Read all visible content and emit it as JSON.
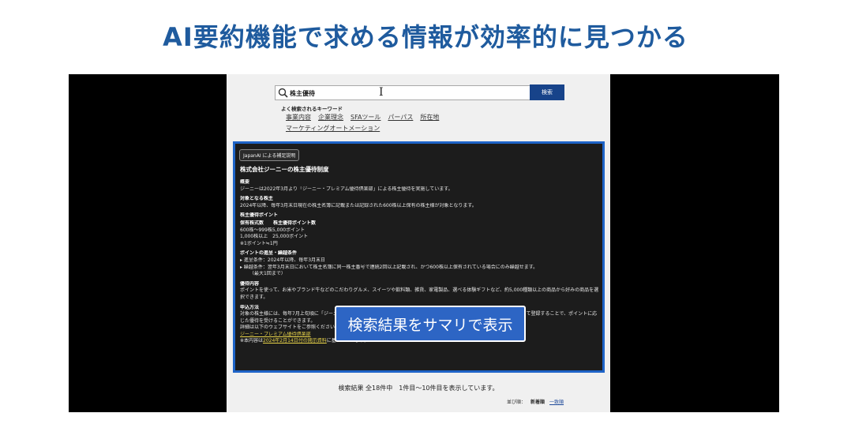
{
  "headline": "AI要約機能で求める情報が効率的に見つかる",
  "search": {
    "value": "株主優待",
    "button_label": "検索"
  },
  "keywords": {
    "title": "よく検索されるキーワード",
    "items": [
      "事業内容",
      "企業理念",
      "SFAツール",
      "パーパス",
      "所在地",
      "マーケティングオートメーション"
    ]
  },
  "ai_summary": {
    "badge": "JapanAI による補足説明",
    "title": "株式会社ジーニーの株主優待制度",
    "overview_head": "概要",
    "overview_text": "ジーニーは2022年3月より「ジーニー・プレミアム優待倶楽部」による株主優待を実施しています。",
    "target_head": "対象となる株主",
    "target_text": "2024年以降、毎年3月末日現在の株主名簿に記載または記録された600株以上保有の株主様が対象となります。",
    "points_head": "株主優待ポイント",
    "points_table_header": "保有株式数　　株主優待ポイント数",
    "points_row1": "600株〜999株5,000ポイント",
    "points_row2": "1,000株以上　25,000ポイント",
    "points_note": "※1ポイント≒1円",
    "carry_head": "ポイントの進呈・繰越条件",
    "carry_item1": "進呈条件：2024年以降、毎年3月末日",
    "carry_item2": "繰越条件：翌年3月末日において株主名簿に同一株主番号で連続2回以上記載され、かつ600株以上保有されている場合にのみ繰越せます。",
    "carry_item2_note": "（最大1回まで）",
    "content_head": "優待内容",
    "content_text": "ポイントを使って、お米やブランド牛などのこだわりグルメ、スイーツや飲料類、雑貨、家電製品、選べる体験ギフトなど、約5,000種類以上の商品から好みの商品を選択できます。",
    "apply_head": "申込方法",
    "apply_text": "対象の株主様には、毎年7月上旬頃に「ジーニー・プレミアム優待倶楽部のご案内」が送付されます。案内に従って特設ウェブサイトにて登録することで、ポイントに応じた優待を受けることができます。",
    "details_text": "詳細は以下のウェブサイトをご参照ください：",
    "link_text": "ジーニー・プレミアム優待倶楽部",
    "source_prefix": "※本内容は",
    "source_link": "2024年2月14日付の開示資料",
    "source_suffix": "に基づいています。"
  },
  "overlay_label": "検索結果をサマリで表示",
  "results": {
    "count_text": "検索結果 全18件中　1件目〜10件目を表示しています。",
    "sort_label": "並び順：",
    "sort_selected": "新着順",
    "sort_alt": "一致順"
  },
  "colors": {
    "headline": "#1f5b9e",
    "search_button": "#17438a",
    "panel_border": "#1e64c8",
    "overlay_bg": "#2d65c4"
  }
}
